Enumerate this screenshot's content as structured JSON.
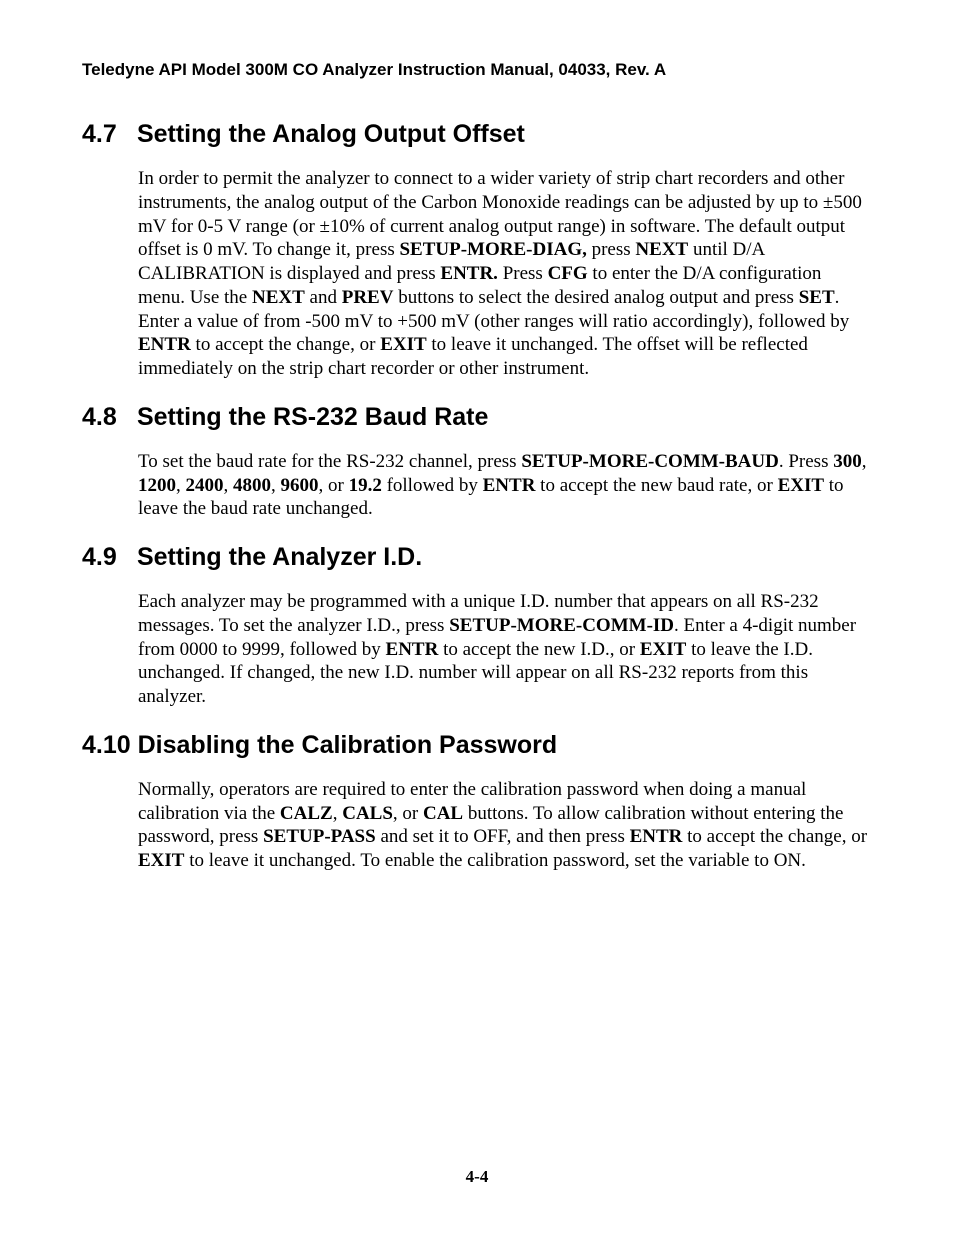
{
  "header": "Teledyne API Model 300M CO Analyzer Instruction Manual, 04033, Rev. A",
  "page_number": "4-4",
  "sections": {
    "s47": {
      "num": "4.7",
      "title": "Setting the Analog Output Offset",
      "p": {
        "t0": "In order to permit the analyzer to connect to a wider variety of strip chart recorders and other instruments, the analog output of the Carbon Monoxide readings can be adjusted by up to ±500 mV for 0-5 V range (or ±10% of current analog output range) in software. The default output offset is 0 mV. To change it, press ",
        "b0": "SETUP-MORE-DIAG,",
        "t1": " press ",
        "b1": "NEXT",
        "t2": " until D/A CALIBRATION is displayed and press ",
        "b2": "ENTR.",
        "t3": " Press ",
        "b3": "CFG",
        "t4": " to enter the D/A configuration menu. Use the ",
        "b4": "NEXT",
        "t5": " and ",
        "b5": "PREV",
        "t6": " buttons to select the desired analog output and press ",
        "b6": "SET",
        "t7": ". Enter a value of from -500 mV to +500 mV (other ranges will ratio accordingly), followed by ",
        "b7": "ENTR",
        "t8": " to accept the change, or ",
        "b8": "EXIT",
        "t9": " to leave it unchanged. The offset will be reflected immediately on the strip chart recorder or other instrument."
      }
    },
    "s48": {
      "num": "4.8",
      "title": "Setting the RS-232 Baud Rate",
      "p": {
        "t0": "To set the baud rate for the RS-232 channel, press ",
        "b0": "SETUP-MORE-COMM-BAUD",
        "t1": ". Press ",
        "b1": "300",
        "t2": ", ",
        "b2": "1200",
        "t3": ", ",
        "b3": "2400",
        "t4": ", ",
        "b4": "4800",
        "t5": ", ",
        "b5": "9600",
        "t6": ", or ",
        "b6": "19.2",
        "t7": " followed by ",
        "b7": "ENTR",
        "t8": " to accept the new baud rate, or ",
        "b8": "EXIT",
        "t9": " to leave the baud rate unchanged."
      }
    },
    "s49": {
      "num": "4.9",
      "title": "Setting the Analyzer I.D.",
      "p": {
        "t0": "Each analyzer may be programmed with a unique I.D. number that appears on all RS-232 messages. To set the analyzer I.D., press ",
        "b0": "SETUP-MORE-COMM-ID",
        "t1": ". Enter a 4-digit number from 0000 to 9999, followed by ",
        "b1": "ENTR",
        "t2": " to accept the new I.D., or ",
        "b2": "EXIT",
        "t3": " to leave the I.D. unchanged. If changed, the new I.D. number will appear on all RS-232 reports from this analyzer."
      }
    },
    "s410": {
      "num": "4.10",
      "title": "Disabling the Calibration Password",
      "p": {
        "t0": "Normally, operators are required to enter the calibration password when doing a manual calibration via the ",
        "b0": "CALZ",
        "t1": ", ",
        "b1": "CALS",
        "t2": ", or ",
        "b2": "CAL",
        "t3": " buttons. To allow calibration without entering the password, press ",
        "b3": "SETUP-PASS",
        "t4": " and set it to OFF, and then press ",
        "b4": "ENTR",
        "t5": " to accept the change, or ",
        "b5": "EXIT",
        "t6": " to leave it unchanged. To enable the calibration password, set the variable to ON."
      }
    }
  }
}
